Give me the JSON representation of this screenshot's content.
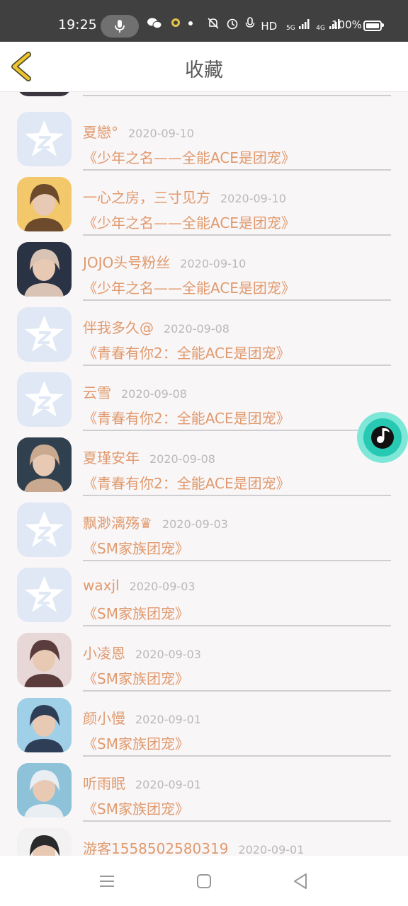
{
  "status_bar": {
    "time": "19:25",
    "network": "HD",
    "signal1_label": "5G",
    "signal2_label": "4G",
    "battery": "100%"
  },
  "header": {
    "title": "收藏"
  },
  "items": [
    {
      "name": "夏戀°",
      "date": "2020-09-10",
      "work": "《少年之名——全能ACE是团宠》",
      "avatar": "default-qq-avatar"
    },
    {
      "name": "一心之房，三寸见方",
      "date": "2020-09-10",
      "work": "《少年之名——全能ACE是团宠》",
      "avatar": "photo"
    },
    {
      "name": "JOJO头号粉丝",
      "date": "2020-09-10",
      "work": "《少年之名——全能ACE是团宠》",
      "avatar": "photo"
    },
    {
      "name": "伴我多久@",
      "date": "2020-09-08",
      "work": "《青春有你2：全能ACE是团宠》",
      "avatar": "default-qq-avatar"
    },
    {
      "name": "云雪",
      "date": "2020-09-08",
      "work": "《青春有你2：全能ACE是团宠》",
      "avatar": "default-qq-avatar"
    },
    {
      "name": "夏瑾安年",
      "date": "2020-09-08",
      "work": "《青春有你2：全能ACE是团宠》",
      "avatar": "photo"
    },
    {
      "name": "飘渺漓殇♛",
      "date": "2020-09-03",
      "work": "《SM家族团宠》",
      "avatar": "default-qq-avatar"
    },
    {
      "name": "waxjl",
      "date": "2020-09-03",
      "work": "《SM家族团宠》",
      "avatar": "default-qq-avatar"
    },
    {
      "name": "小凌恩",
      "date": "2020-09-03",
      "work": "《SM家族团宠》",
      "avatar": "photo"
    },
    {
      "name": "颜小慢",
      "date": "2020-09-01",
      "work": "《SM家族团宠》",
      "avatar": "photo"
    },
    {
      "name": "听雨眠",
      "date": "2020-09-01",
      "work": "《SM家族团宠》",
      "avatar": "photo"
    },
    {
      "name": "游客1558502580319",
      "date": "2020-09-01",
      "work": "",
      "avatar": "photo"
    }
  ],
  "colors": {
    "accent": "#e09a6d",
    "date": "#b9b9b9",
    "music": "#27c9b3"
  }
}
